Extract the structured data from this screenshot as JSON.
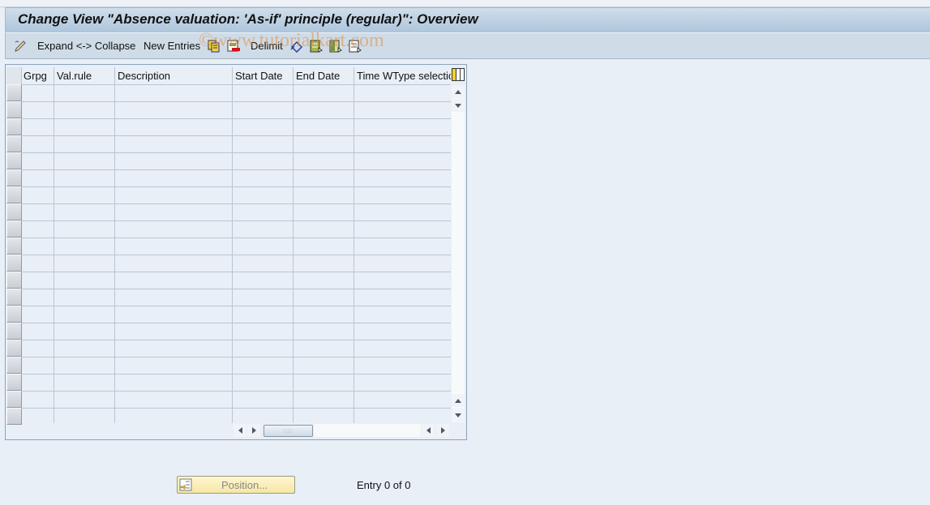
{
  "window": {
    "title": "Change View \"Absence valuation: 'As-if' principle (regular)\": Overview"
  },
  "toolbar": {
    "items": [
      {
        "icon": "display-change-icon"
      },
      {
        "label": "Expand <-> Collapse"
      },
      {
        "label": "New Entries"
      },
      {
        "icon": "copy-icon"
      },
      {
        "icon": "delete-icon"
      },
      {
        "label": "Delimit"
      },
      {
        "icon": "undo-change-icon"
      },
      {
        "icon": "select-all-icon"
      },
      {
        "icon": "select-block-icon"
      },
      {
        "icon": "deselect-all-icon"
      }
    ],
    "watermark": "©www.tutorialkart.com"
  },
  "table": {
    "columns": [
      "Grpg",
      "Val.rule",
      "Description",
      "Start Date",
      "End Date",
      "Time WType selectio"
    ],
    "rows": [],
    "visible_empty_rows": 20
  },
  "footer": {
    "position_button": "Position...",
    "entry_info": "Entry 0 of 0"
  }
}
